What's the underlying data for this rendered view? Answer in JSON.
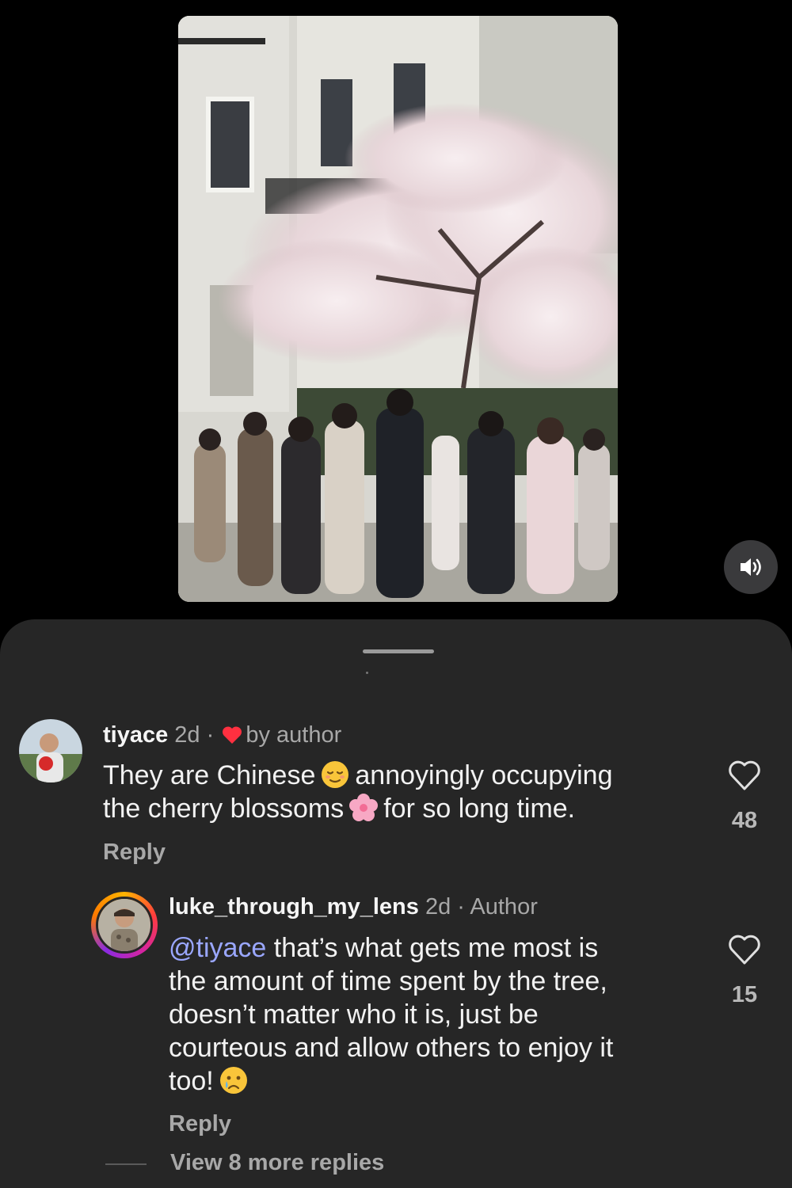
{
  "comments": [
    {
      "username": "tiyace",
      "time": "2d",
      "separator": "·",
      "badge": "by author",
      "text_line1_before": "They are Chinese",
      "text_line1_after": "annoyingly occupying",
      "text_line2_before": "the cherry blossoms",
      "text_line2_after": "for so long time.",
      "emoji1": "relieved-face",
      "emoji2": "cherry-blossom",
      "reply_label": "Reply",
      "like_count": "48"
    }
  ],
  "reply": {
    "username": "luke_through_my_lens",
    "time": "2d",
    "separator": "·",
    "badge": "Author",
    "mention": "@tiyace",
    "text_line1": "that’s what gets me most is",
    "text_line2": "the amount of time spent by the tree,",
    "text_line3": "doesn’t matter who it is, just be",
    "text_line4": "courteous and allow others to enjoy it",
    "text_line5": "too!",
    "emoji": "crying-face",
    "reply_label": "Reply",
    "like_count": "15"
  },
  "view_more_label": "View 8 more replies",
  "icons": {
    "mute": "speaker-icon",
    "like": "heart-outline-icon",
    "liked_by_author": "red-heart-icon"
  },
  "colors": {
    "sheet_bg": "#262626",
    "mention": "#9aa7ff",
    "author_heart": "#ff3040"
  }
}
